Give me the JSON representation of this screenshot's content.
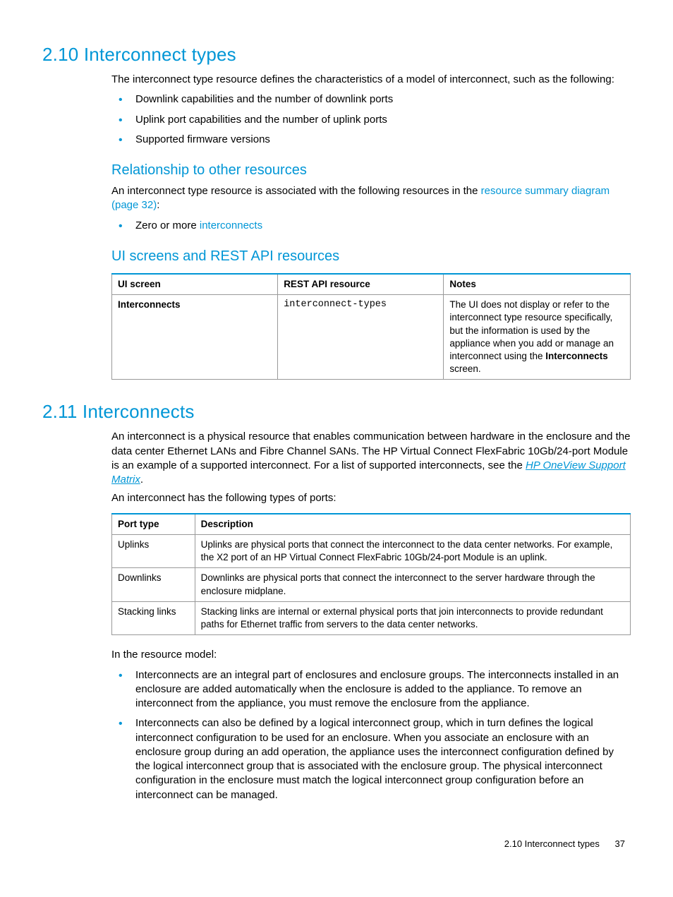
{
  "section210": {
    "title": "2.10 Interconnect types",
    "intro": "The interconnect type resource defines the characteristics of a model of interconnect, such as the following:",
    "bullets": [
      "Downlink capabilities and the number of downlink ports",
      "Uplink port capabilities and the number of uplink ports",
      "Supported firmware versions"
    ],
    "rel_title": "Relationship to other resources",
    "rel_text_pre": "An interconnect type resource is associated with the following resources in the ",
    "rel_link": "resource summary diagram (page 32)",
    "rel_text_post": ":",
    "rel_bullet_pre": "Zero or more ",
    "rel_bullet_link": "interconnects",
    "ui_title": "UI screens and REST API resources",
    "table1": {
      "headers": [
        "UI screen",
        "REST API resource",
        "Notes"
      ],
      "row": {
        "ui": "Interconnects",
        "api": "interconnect-types",
        "notes_pre": "The UI does not display or refer to the interconnect type resource specifically, but the information is used by the appliance when you add or manage an interconnect using the ",
        "notes_bold": "Interconnects",
        "notes_post": " screen."
      }
    }
  },
  "section211": {
    "title": "2.11 Interconnects",
    "intro_pre": "An interconnect is a physical resource that enables communication between hardware in the enclosure and the data center Ethernet LANs and Fibre Channel SANs. The HP Virtual Connect FlexFabric 10Gb/24-port Module is an example of a supported interconnect. For a list of supported interconnects, see the ",
    "intro_link": "HP OneView Support Matrix",
    "intro_post": ".",
    "ports_intro": "An interconnect has the following types of ports:",
    "table2": {
      "headers": [
        "Port type",
        "Description"
      ],
      "rows": [
        {
          "type": "Uplinks",
          "desc": "Uplinks are physical ports that connect the interconnect to the data center networks. For example, the X2 port of an HP Virtual Connect FlexFabric 10Gb/24-port Module is an uplink."
        },
        {
          "type": "Downlinks",
          "desc": "Downlinks are physical ports that connect the interconnect to the server hardware through the enclosure midplane."
        },
        {
          "type": "Stacking links",
          "desc": "Stacking links are internal or external physical ports that join interconnects to provide redundant paths for Ethernet traffic from servers to the data center networks."
        }
      ]
    },
    "model_intro": "In the resource model:",
    "model_bullets": [
      "Interconnects are an integral part of enclosures and enclosure groups. The interconnects installed in an enclosure are added automatically when the enclosure is added to the appliance. To remove an interconnect from the appliance, you must remove the enclosure from the appliance.",
      "Interconnects can also be defined by a logical interconnect group, which in turn defines the logical interconnect configuration to be used for an enclosure. When you associate an enclosure with an enclosure group during an add operation, the appliance uses the interconnect configuration defined by the logical interconnect group that is associated with the enclosure group. The physical interconnect configuration in the enclosure must match the logical interconnect group configuration before an interconnect can be managed."
    ]
  },
  "footer": {
    "text": "2.10 Interconnect types",
    "page": "37"
  }
}
